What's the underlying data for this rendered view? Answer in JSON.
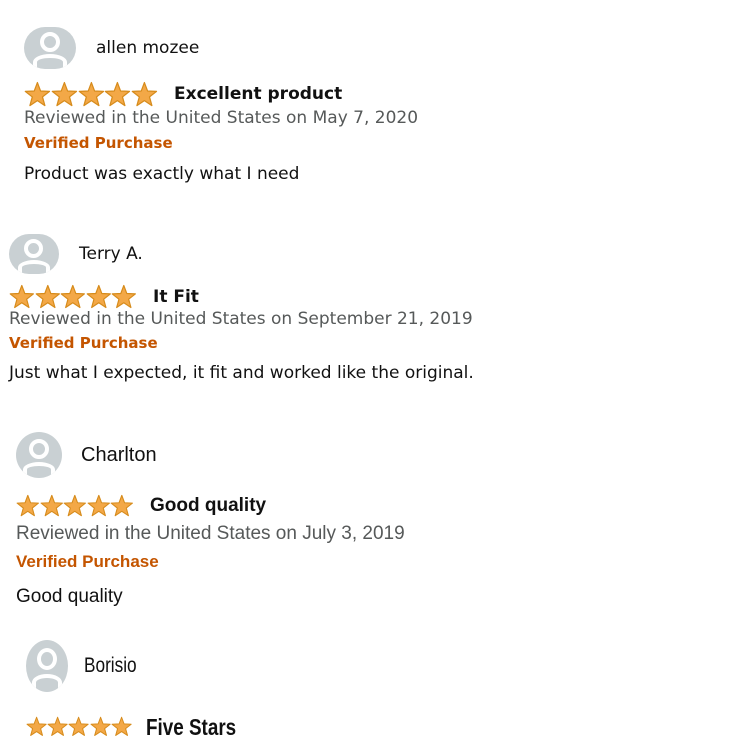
{
  "colors": {
    "star": "#f3a847",
    "star_stroke": "#d68b1b",
    "verified": "#c45500",
    "date": "#565959",
    "avatar_bg": "#c9d0d3"
  },
  "icons": {
    "avatar": "person-avatar-icon",
    "star": "star-icon"
  },
  "reviews": [
    {
      "author": "allen mozee",
      "rating": 5,
      "title": "Excellent product",
      "date": "Reviewed in the United States on May 7, 2020",
      "verified": "Verified Purchase",
      "body": "Product was exactly what I need"
    },
    {
      "author": "Terry A.",
      "rating": 5,
      "title": "It Fit",
      "date": "Reviewed in the United States on September 21, 2019",
      "verified": "Verified Purchase",
      "body": "Just what I expected, it fit and worked like the original."
    },
    {
      "author": "Charlton",
      "rating": 5,
      "title": "Good quality",
      "date": "Reviewed in the United States on July 3, 2019",
      "verified": "Verified Purchase",
      "body": "Good quality"
    },
    {
      "author": "Borisio",
      "rating": 5,
      "title": "Five Stars"
    }
  ]
}
